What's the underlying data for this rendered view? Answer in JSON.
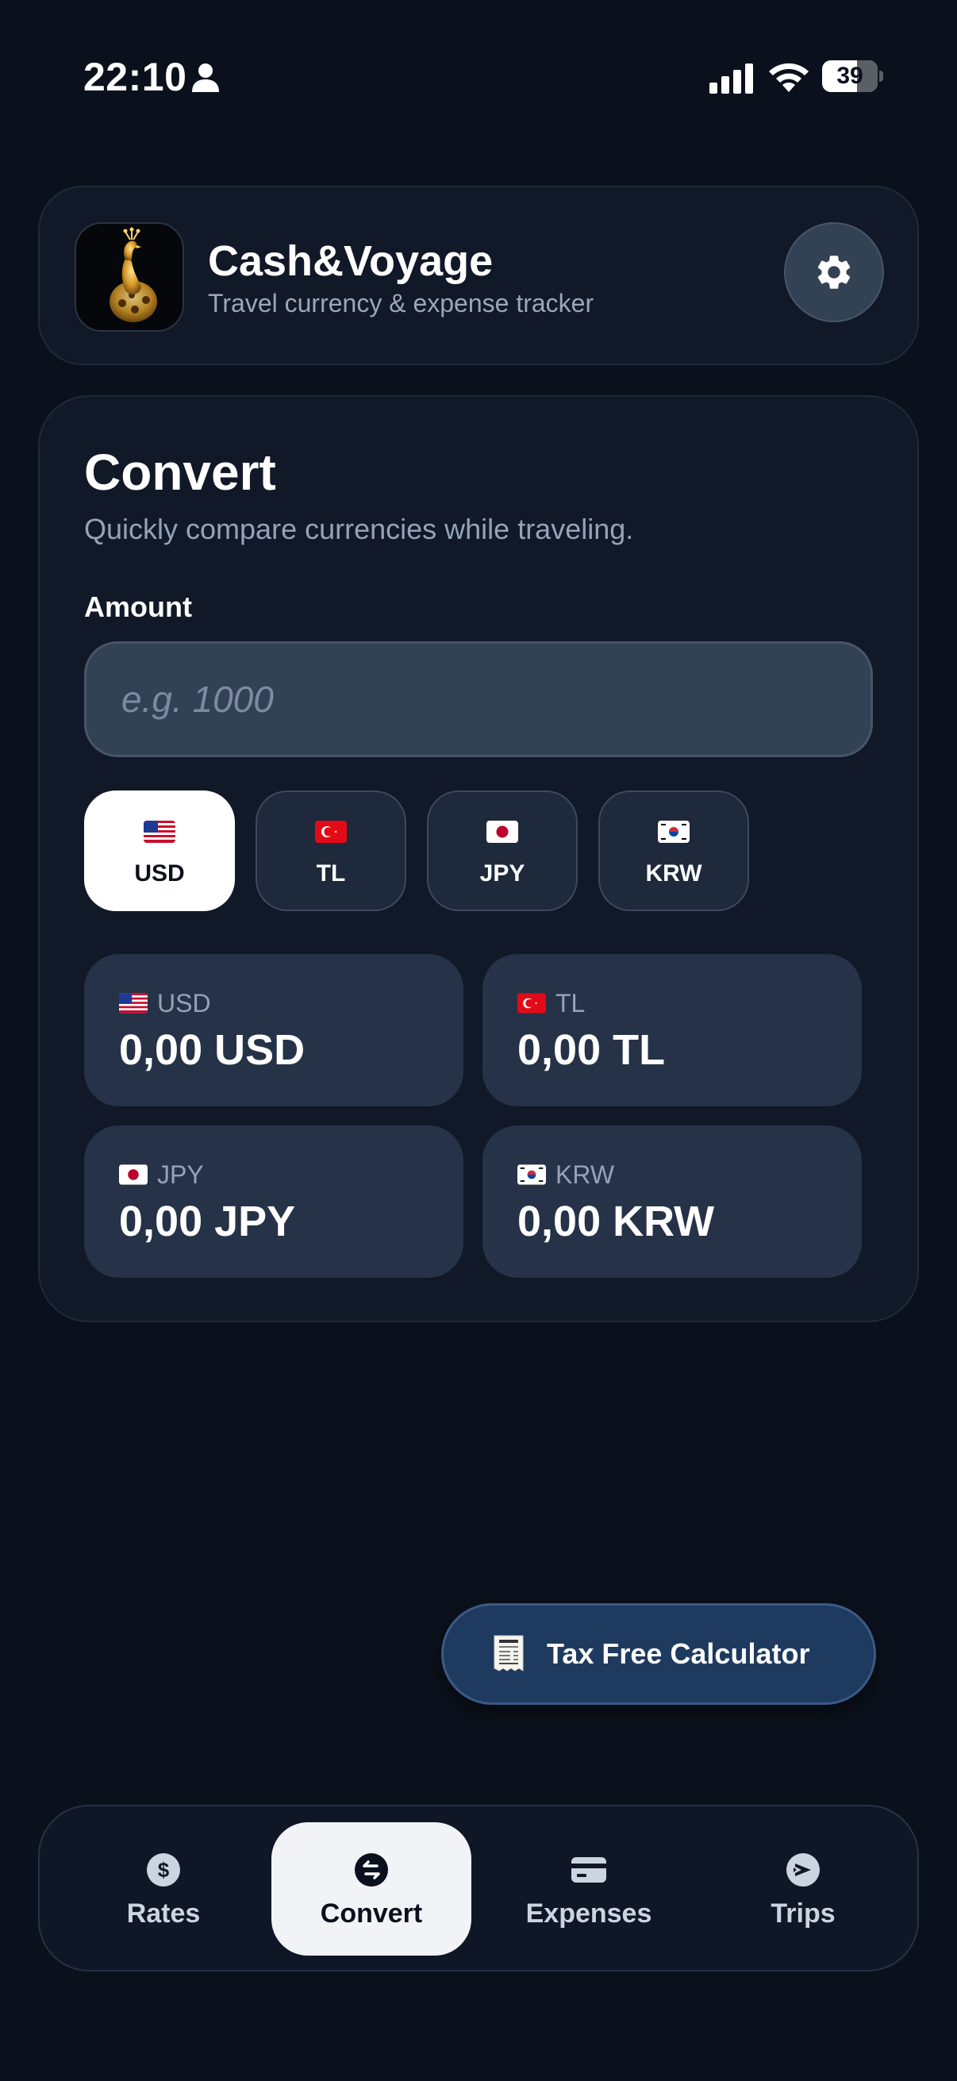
{
  "status_bar": {
    "time": "22:10",
    "battery_level": "39",
    "icons": [
      "person-icon",
      "signal-icon",
      "wifi-icon",
      "battery-icon"
    ]
  },
  "header": {
    "title": "Cash&Voyage",
    "subtitle": "Travel currency & expense tracker",
    "logo_icon": "peacock-logo",
    "settings_icon": "gear-icon"
  },
  "convert": {
    "title": "Convert",
    "subtitle": "Quickly compare currencies while traveling.",
    "amount_label": "Amount",
    "amount_value": "",
    "amount_placeholder": "e.g. 1000",
    "currencies": [
      {
        "code": "USD",
        "flag": "us-flag-icon",
        "selected": true
      },
      {
        "code": "TL",
        "flag": "tr-flag-icon",
        "selected": false
      },
      {
        "code": "JPY",
        "flag": "jp-flag-icon",
        "selected": false
      },
      {
        "code": "KRW",
        "flag": "kr-flag-icon",
        "selected": false
      }
    ],
    "results": [
      {
        "code": "USD",
        "value": "0,00 USD"
      },
      {
        "code": "TL",
        "value": "0,00 TL"
      },
      {
        "code": "JPY",
        "value": "0,00 JPY"
      },
      {
        "code": "KRW",
        "value": "0,00 KRW"
      }
    ]
  },
  "tax_free": {
    "label": "Tax Free Calculator",
    "icon": "receipt-icon"
  },
  "nav": {
    "items": [
      {
        "label": "Rates",
        "icon": "dollar-icon",
        "active": false
      },
      {
        "label": "Convert",
        "icon": "exchange-icon",
        "active": true
      },
      {
        "label": "Expenses",
        "icon": "card-icon",
        "active": false
      },
      {
        "label": "Trips",
        "icon": "airplane-icon",
        "active": false
      }
    ]
  },
  "colors": {
    "background": "#0b111c",
    "card": "#111827",
    "tile": "#253247",
    "input": "#334155",
    "active_chip": "#ffffff",
    "tax_button": "#1e3a5f",
    "text_muted": "#94a3b8"
  }
}
